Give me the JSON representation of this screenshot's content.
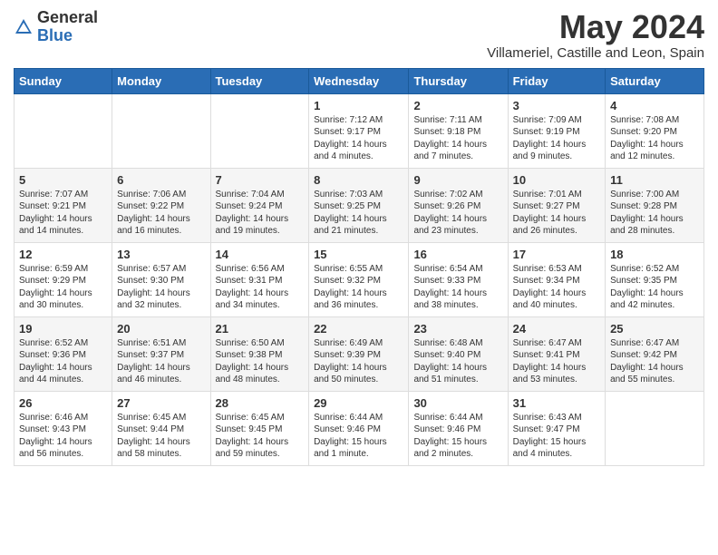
{
  "header": {
    "logo_general": "General",
    "logo_blue": "Blue",
    "main_title": "May 2024",
    "subtitle": "Villameriel, Castille and Leon, Spain"
  },
  "weekdays": [
    "Sunday",
    "Monday",
    "Tuesday",
    "Wednesday",
    "Thursday",
    "Friday",
    "Saturday"
  ],
  "weeks": [
    [
      {
        "day": "",
        "info": ""
      },
      {
        "day": "",
        "info": ""
      },
      {
        "day": "",
        "info": ""
      },
      {
        "day": "1",
        "info": "Sunrise: 7:12 AM\nSunset: 9:17 PM\nDaylight: 14 hours\nand 4 minutes."
      },
      {
        "day": "2",
        "info": "Sunrise: 7:11 AM\nSunset: 9:18 PM\nDaylight: 14 hours\nand 7 minutes."
      },
      {
        "day": "3",
        "info": "Sunrise: 7:09 AM\nSunset: 9:19 PM\nDaylight: 14 hours\nand 9 minutes."
      },
      {
        "day": "4",
        "info": "Sunrise: 7:08 AM\nSunset: 9:20 PM\nDaylight: 14 hours\nand 12 minutes."
      }
    ],
    [
      {
        "day": "5",
        "info": "Sunrise: 7:07 AM\nSunset: 9:21 PM\nDaylight: 14 hours\nand 14 minutes."
      },
      {
        "day": "6",
        "info": "Sunrise: 7:06 AM\nSunset: 9:22 PM\nDaylight: 14 hours\nand 16 minutes."
      },
      {
        "day": "7",
        "info": "Sunrise: 7:04 AM\nSunset: 9:24 PM\nDaylight: 14 hours\nand 19 minutes."
      },
      {
        "day": "8",
        "info": "Sunrise: 7:03 AM\nSunset: 9:25 PM\nDaylight: 14 hours\nand 21 minutes."
      },
      {
        "day": "9",
        "info": "Sunrise: 7:02 AM\nSunset: 9:26 PM\nDaylight: 14 hours\nand 23 minutes."
      },
      {
        "day": "10",
        "info": "Sunrise: 7:01 AM\nSunset: 9:27 PM\nDaylight: 14 hours\nand 26 minutes."
      },
      {
        "day": "11",
        "info": "Sunrise: 7:00 AM\nSunset: 9:28 PM\nDaylight: 14 hours\nand 28 minutes."
      }
    ],
    [
      {
        "day": "12",
        "info": "Sunrise: 6:59 AM\nSunset: 9:29 PM\nDaylight: 14 hours\nand 30 minutes."
      },
      {
        "day": "13",
        "info": "Sunrise: 6:57 AM\nSunset: 9:30 PM\nDaylight: 14 hours\nand 32 minutes."
      },
      {
        "day": "14",
        "info": "Sunrise: 6:56 AM\nSunset: 9:31 PM\nDaylight: 14 hours\nand 34 minutes."
      },
      {
        "day": "15",
        "info": "Sunrise: 6:55 AM\nSunset: 9:32 PM\nDaylight: 14 hours\nand 36 minutes."
      },
      {
        "day": "16",
        "info": "Sunrise: 6:54 AM\nSunset: 9:33 PM\nDaylight: 14 hours\nand 38 minutes."
      },
      {
        "day": "17",
        "info": "Sunrise: 6:53 AM\nSunset: 9:34 PM\nDaylight: 14 hours\nand 40 minutes."
      },
      {
        "day": "18",
        "info": "Sunrise: 6:52 AM\nSunset: 9:35 PM\nDaylight: 14 hours\nand 42 minutes."
      }
    ],
    [
      {
        "day": "19",
        "info": "Sunrise: 6:52 AM\nSunset: 9:36 PM\nDaylight: 14 hours\nand 44 minutes."
      },
      {
        "day": "20",
        "info": "Sunrise: 6:51 AM\nSunset: 9:37 PM\nDaylight: 14 hours\nand 46 minutes."
      },
      {
        "day": "21",
        "info": "Sunrise: 6:50 AM\nSunset: 9:38 PM\nDaylight: 14 hours\nand 48 minutes."
      },
      {
        "day": "22",
        "info": "Sunrise: 6:49 AM\nSunset: 9:39 PM\nDaylight: 14 hours\nand 50 minutes."
      },
      {
        "day": "23",
        "info": "Sunrise: 6:48 AM\nSunset: 9:40 PM\nDaylight: 14 hours\nand 51 minutes."
      },
      {
        "day": "24",
        "info": "Sunrise: 6:47 AM\nSunset: 9:41 PM\nDaylight: 14 hours\nand 53 minutes."
      },
      {
        "day": "25",
        "info": "Sunrise: 6:47 AM\nSunset: 9:42 PM\nDaylight: 14 hours\nand 55 minutes."
      }
    ],
    [
      {
        "day": "26",
        "info": "Sunrise: 6:46 AM\nSunset: 9:43 PM\nDaylight: 14 hours\nand 56 minutes."
      },
      {
        "day": "27",
        "info": "Sunrise: 6:45 AM\nSunset: 9:44 PM\nDaylight: 14 hours\nand 58 minutes."
      },
      {
        "day": "28",
        "info": "Sunrise: 6:45 AM\nSunset: 9:45 PM\nDaylight: 14 hours\nand 59 minutes."
      },
      {
        "day": "29",
        "info": "Sunrise: 6:44 AM\nSunset: 9:46 PM\nDaylight: 15 hours\nand 1 minute."
      },
      {
        "day": "30",
        "info": "Sunrise: 6:44 AM\nSunset: 9:46 PM\nDaylight: 15 hours\nand 2 minutes."
      },
      {
        "day": "31",
        "info": "Sunrise: 6:43 AM\nSunset: 9:47 PM\nDaylight: 15 hours\nand 4 minutes."
      },
      {
        "day": "",
        "info": ""
      }
    ]
  ]
}
